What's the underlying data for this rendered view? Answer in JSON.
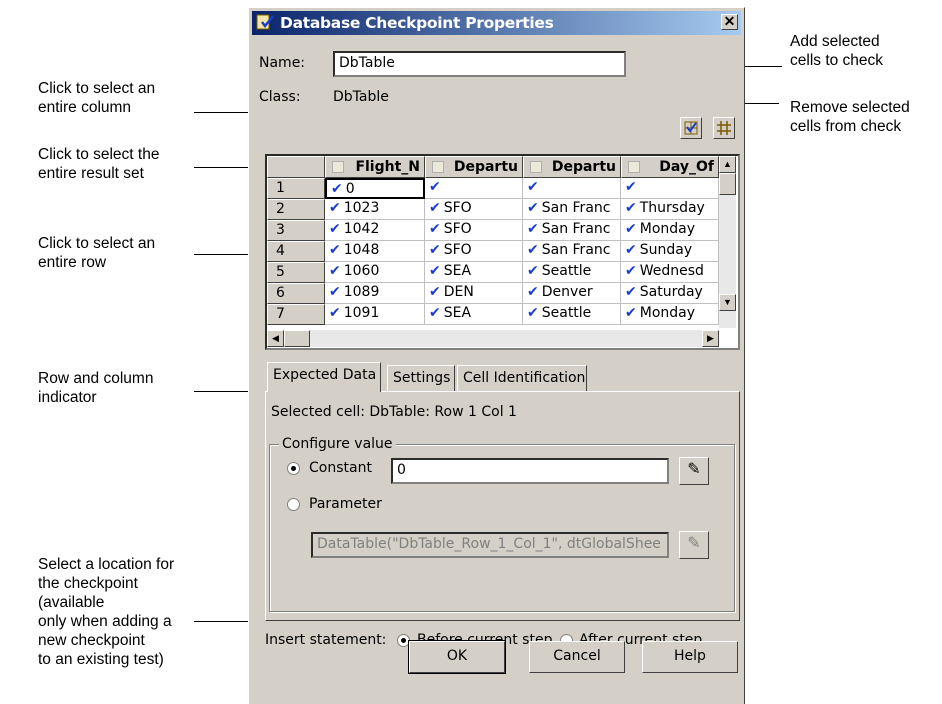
{
  "annotations": {
    "left": [
      "Click to select an\nentire column",
      "Click to select the\nentire result set",
      "Click to select an\nentire row",
      "Row and column\nindicator",
      "Select a location for\nthe  checkpoint\n(available\nonly when adding a\nnew checkpoint\nto an existing test)"
    ],
    "right": [
      "Add selected\ncells to check",
      "Remove selected\ncells from check"
    ]
  },
  "dialog": {
    "title": "Database Checkpoint Properties",
    "close_glyph": "✕",
    "name_label": "Name:",
    "name_value": "DbTable",
    "class_label": "Class:",
    "class_value": "DbTable"
  },
  "grid": {
    "columns": [
      "Flight_N",
      "Departu",
      "Departu",
      "Day_Of"
    ],
    "rows": [
      {
        "num": "1",
        "cells": [
          "0",
          "",
          "",
          ""
        ]
      },
      {
        "num": "2",
        "cells": [
          "1023",
          "SFO",
          "San Franc",
          "Thursday"
        ]
      },
      {
        "num": "3",
        "cells": [
          "1042",
          "SFO",
          "San Franc",
          "Monday"
        ]
      },
      {
        "num": "4",
        "cells": [
          "1048",
          "SFO",
          "San Franc",
          "Sunday"
        ]
      },
      {
        "num": "5",
        "cells": [
          "1060",
          "SEA",
          "Seattle",
          "Wednesd"
        ]
      },
      {
        "num": "6",
        "cells": [
          "1089",
          "DEN",
          "Denver",
          "Saturday"
        ]
      },
      {
        "num": "7",
        "cells": [
          "1091",
          "SEA",
          "Seattle",
          "Monday"
        ]
      }
    ],
    "check_glyph": "✔"
  },
  "tabs": [
    "Expected Data",
    "Settings",
    "Cell Identification"
  ],
  "expected": {
    "selected_cell": "Selected cell: DbTable: Row 1 Col 1",
    "group_title": "Configure value",
    "constant_label": "Constant",
    "constant_value": "0",
    "parameter_label": "Parameter",
    "parameter_value": "DataTable(\"DbTable_Row_1_Col_1\", dtGlobalShee"
  },
  "insert": {
    "label": "Insert statement:",
    "before": "Before current step",
    "after": "After current step"
  },
  "buttons": {
    "ok": "OK",
    "cancel": "Cancel",
    "help": "Help"
  }
}
